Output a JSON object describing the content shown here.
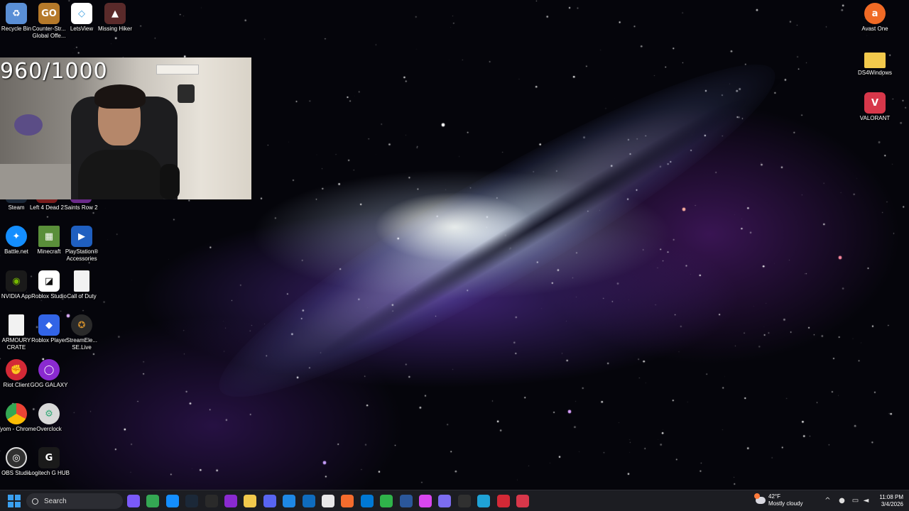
{
  "overlay": {
    "viewer_count": "960/1000"
  },
  "desktop_icons_left": [
    {
      "label": "Recycle Bin",
      "icon": "recycle-bin-icon",
      "color": "#5a8fd6"
    },
    {
      "label": "Counter-Str... Global Offe...",
      "icon": "csgo-icon",
      "color": "#b5792a"
    },
    {
      "label": "LetsView",
      "icon": "letsview-icon",
      "color": "#3fa0e0"
    },
    {
      "label": "Missing Hiker",
      "icon": "missing-hiker-icon",
      "color": "#8b2a2a"
    },
    {
      "label": "Steam",
      "icon": "steam-icon",
      "color": "#1b2838"
    },
    {
      "label": "Left 4 Dead 2",
      "icon": "left4dead-icon",
      "color": "#7a1d1d"
    },
    {
      "label": "Saints Row 2",
      "icon": "saints-row-icon",
      "color": "#6a2a8a"
    },
    {
      "label": "Battle.net",
      "icon": "battlenet-icon",
      "color": "#148eff"
    },
    {
      "label": "Minecraft",
      "icon": "minecraft-icon",
      "color": "#5a8f3a"
    },
    {
      "label": "PlayStation® Accessories",
      "icon": "playstation-icon",
      "color": "#1f5fc0"
    },
    {
      "label": "NVIDIA App",
      "icon": "nvidia-icon",
      "color": "#76b900"
    },
    {
      "label": "Roblox Studio",
      "icon": "roblox-studio-icon",
      "color": "#e8e8e8"
    },
    {
      "label": "Call of Duty",
      "icon": "document-icon",
      "color": "#f2f2f2"
    },
    {
      "label": "ARMOURY CRATE",
      "icon": "document-icon",
      "color": "#f2f2f2"
    },
    {
      "label": "Roblox Player",
      "icon": "roblox-icon",
      "color": "#3264e6"
    },
    {
      "label": "StreamEle... SE.Live",
      "icon": "streamelements-icon",
      "color": "#c98a2c"
    },
    {
      "label": "Riot Client",
      "icon": "riot-icon",
      "color": "#d32936"
    },
    {
      "label": "GOG GALAXY",
      "icon": "gog-icon",
      "color": "#8a2ad0"
    },
    {
      "label": "Vyom - Chrome",
      "icon": "chrome-icon",
      "color": "#ea4335"
    },
    {
      "label": "Overclock",
      "icon": "overclock-icon",
      "color": "#d8d8d8"
    },
    {
      "label": "OBS Studio",
      "icon": "obs-icon",
      "color": "#303030"
    },
    {
      "label": "Logitech G HUB",
      "icon": "logitech-icon",
      "color": "#1a1a1a"
    }
  ],
  "desktop_icons_right": [
    {
      "label": "Avast One",
      "icon": "avast-icon",
      "color": "#f06a25"
    },
    {
      "label": "DS4Windows",
      "icon": "folder-icon",
      "color": "#f2c94c"
    },
    {
      "label": "VALORANT",
      "icon": "valorant-icon",
      "color": "#d7374a"
    }
  ],
  "taskbar": {
    "search_label": "Search",
    "apps": [
      {
        "icon": "copilot-icon",
        "color": "#7a5af8"
      },
      {
        "icon": "chrome-icon",
        "color": "#34a853"
      },
      {
        "icon": "battlenet-icon",
        "color": "#148eff"
      },
      {
        "icon": "steam-icon",
        "color": "#1b2838"
      },
      {
        "icon": "epic-games-icon",
        "color": "#2a2a2a"
      },
      {
        "icon": "gog-icon",
        "color": "#8a2ad0"
      },
      {
        "icon": "file-explorer-icon",
        "color": "#f2c94c"
      },
      {
        "icon": "discord-icon",
        "color": "#5865f2"
      },
      {
        "icon": "mail-icon",
        "color": "#1e88e5"
      },
      {
        "icon": "outlook-icon",
        "color": "#0f6cbd"
      },
      {
        "icon": "store-icon",
        "color": "#e8e8e8"
      },
      {
        "icon": "origin-icon",
        "color": "#f56c2d"
      },
      {
        "icon": "vscode-icon",
        "color": "#0078d4"
      },
      {
        "icon": "xbox-icon",
        "color": "#2fb34a"
      },
      {
        "icon": "word-icon",
        "color": "#2b579a"
      },
      {
        "icon": "music-icon",
        "color": "#d946ef"
      },
      {
        "icon": "gamepad-icon",
        "color": "#7c6cf0"
      },
      {
        "icon": "obs-icon",
        "color": "#303030"
      },
      {
        "icon": "edge-icon",
        "color": "#1fa2d6"
      },
      {
        "icon": "riot-icon",
        "color": "#d32936"
      },
      {
        "icon": "valorant-icon",
        "color": "#d7374a"
      }
    ],
    "weather": {
      "temperature": "42°F",
      "condition": "Mostly cloudy"
    },
    "clock": {
      "time": "11:08 PM",
      "date": "3/4/2026"
    }
  }
}
